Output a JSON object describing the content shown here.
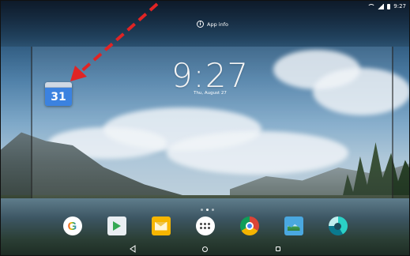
{
  "status_bar": {
    "time": "9:27",
    "icons": [
      "wifi-icon",
      "signal-icon",
      "battery-icon"
    ]
  },
  "app_info": {
    "label": "App info",
    "icon": "info-icon"
  },
  "clock": {
    "time": "9:27",
    "date": "Thu, August 27"
  },
  "dragged_app": {
    "name": "calendar",
    "day": "31"
  },
  "page_indicator": {
    "pages": 3,
    "active_index": 1
  },
  "dock": {
    "apps": [
      {
        "name": "google-app",
        "glyph": "G"
      },
      {
        "name": "play-store-app",
        "glyph": ""
      },
      {
        "name": "email-app",
        "glyph": ""
      },
      {
        "name": "app-launcher",
        "glyph": ""
      },
      {
        "name": "chrome-app",
        "glyph": ""
      },
      {
        "name": "photos-app",
        "glyph": ""
      },
      {
        "name": "camera-app",
        "glyph": ""
      }
    ]
  },
  "nav_bar": {
    "buttons": [
      "back",
      "home",
      "recents"
    ]
  },
  "colors": {
    "arrow": "#e02424",
    "calendar_blue": "#3b82e0"
  }
}
